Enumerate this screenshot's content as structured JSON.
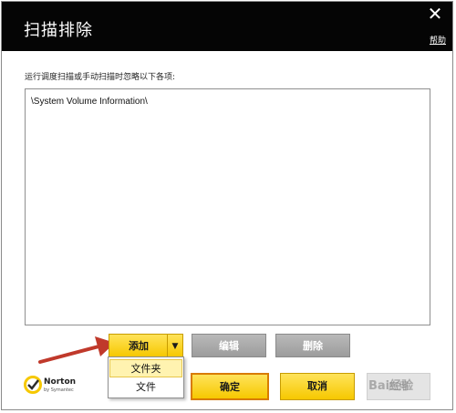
{
  "dialog": {
    "title": "扫描排除",
    "help_link": "帮助",
    "close_glyph": "✕",
    "instruction": "运行调度扫描或手动扫描时忽略以下各项:"
  },
  "exclusions": {
    "items": [
      "\\System Volume Information\\"
    ]
  },
  "buttons": {
    "add": "添加",
    "add_arrow": "▼",
    "edit": "编辑",
    "delete": "删除",
    "ok": "确定",
    "cancel": "取消",
    "apply": "应用"
  },
  "add_menu": {
    "items": [
      "文件夹",
      "文件"
    ],
    "highlighted": "文件夹"
  },
  "branding": {
    "logo_name": "Norton",
    "logo_sub": "by Symantec"
  },
  "watermark": "Bai经验",
  "colors": {
    "header_bg": "#050505",
    "accent_yellow": "#f6c800",
    "annotation_arrow": "#c0392b"
  }
}
